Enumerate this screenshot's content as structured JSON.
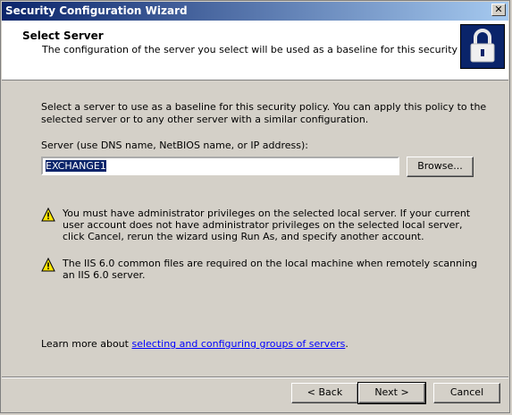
{
  "window": {
    "title": "Security Configuration Wizard",
    "close_glyph": "✕"
  },
  "header": {
    "title": "Select Server",
    "subtitle": "The configuration of the server you select will be used as a baseline for this security policy."
  },
  "body": {
    "intro": "Select a server to use as a baseline for this security policy. You can apply this policy to the selected server or to any other server with a similar configuration.",
    "field_label": "Server (use DNS name, NetBIOS name, or IP address):",
    "server_value": "EXCHANGE1",
    "browse_label": "Browse...",
    "warnings": [
      "You must have administrator privileges on the selected local server. If your current user account does not have administrator privileges on the selected local server, click Cancel, rerun the wizard using Run As, and specify another account.",
      "The IIS 6.0 common files are required on the local machine when remotely scanning an IIS 6.0 server."
    ],
    "learn_prefix": "Learn more about ",
    "learn_link": "selecting and configuring groups of servers",
    "learn_suffix": "."
  },
  "footer": {
    "back_label": "< Back",
    "next_label": "Next >",
    "cancel_label": "Cancel"
  },
  "icons": {
    "close": "close-icon",
    "logo": "padlock-logo",
    "warning": "warning-icon"
  },
  "colors": {
    "titlebar": "#0a246a",
    "link": "#0000ff",
    "selection": "#0a246a",
    "warning": "#ffe600"
  }
}
